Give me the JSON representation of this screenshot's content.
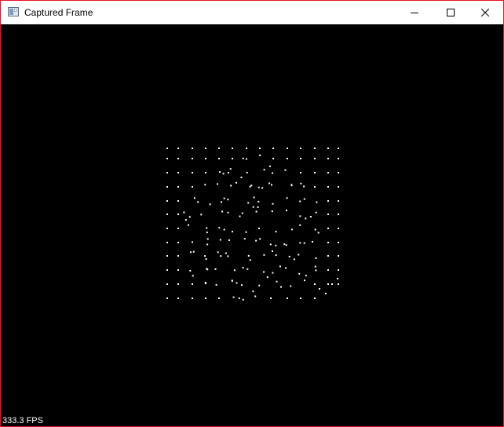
{
  "window": {
    "title": "Captured Frame",
    "icon": "window-app-icon",
    "controls": [
      "minimize-icon",
      "maximize-icon",
      "close-icon"
    ]
  },
  "overlay": {
    "fps_text": "333.3 FPS"
  },
  "scene": {
    "background_color": "#000000",
    "point_color": "#ffffff",
    "pattern": "grid of tracked feature points, distorted in the middle"
  }
}
